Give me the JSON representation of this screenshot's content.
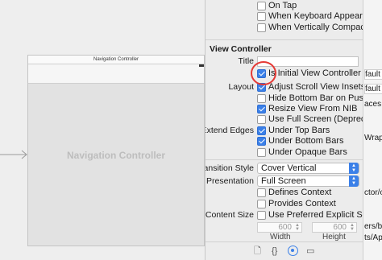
{
  "canvas": {
    "scene_title": "Navigation Controller",
    "scene_body": "Navigation Controller"
  },
  "inspector": {
    "top_options": [
      {
        "label": "On Tap",
        "checked": false
      },
      {
        "label": "When Keyboard Appears",
        "checked": false
      },
      {
        "label": "When Vertically Compact",
        "checked": false
      }
    ],
    "section_title": "View Controller",
    "title_label": "Title",
    "title_value": "",
    "initial_vc": {
      "label": "Is Initial View Controller",
      "checked": true
    },
    "layout_label": "Layout",
    "layout_options": [
      {
        "label": "Adjust Scroll View Insets",
        "checked": true
      },
      {
        "label": "Hide Bottom Bar on Push",
        "checked": false
      },
      {
        "label": "Resize View From NIB",
        "checked": true
      },
      {
        "label": "Use Full Screen (Deprecated)",
        "checked": false
      }
    ],
    "extend_edges_label": "Extend Edges",
    "extend_edges_options": [
      {
        "label": "Under Top Bars",
        "checked": true
      },
      {
        "label": "Under Bottom Bars",
        "checked": true
      },
      {
        "label": "Under Opaque Bars",
        "checked": false
      }
    ],
    "transition_style_label": "Transition Style",
    "transition_style_value": "Cover Vertical",
    "presentation_label": "Presentation",
    "presentation_value": "Full Screen",
    "presentation_options": [
      {
        "label": "Defines Context",
        "checked": false
      },
      {
        "label": "Provides Context",
        "checked": false
      }
    ],
    "content_size_label": "Content Size",
    "content_size_option": {
      "label": "Use Preferred Explicit Size",
      "checked": false
    },
    "width_value": "600",
    "height_value": "600",
    "width_label": "Width",
    "height_label": "Height",
    "tabs": [
      {
        "icon": "file-inspector-icon",
        "glyph": "🗋"
      },
      {
        "icon": "quick-help-icon",
        "glyph": "{}"
      },
      {
        "icon": "attributes-inspector-icon",
        "glyph": ""
      },
      {
        "icon": "size-inspector-icon",
        "glyph": "▭"
      }
    ]
  },
  "right_panel": {
    "fragments": [
      "fault -",
      "fault -",
      "aces",
      "Wrap ll",
      "ctor/o",
      "ers/bo",
      "ts/App"
    ]
  },
  "colors": {
    "accent": "#3b80e8",
    "highlight_circle": "#e53935"
  }
}
